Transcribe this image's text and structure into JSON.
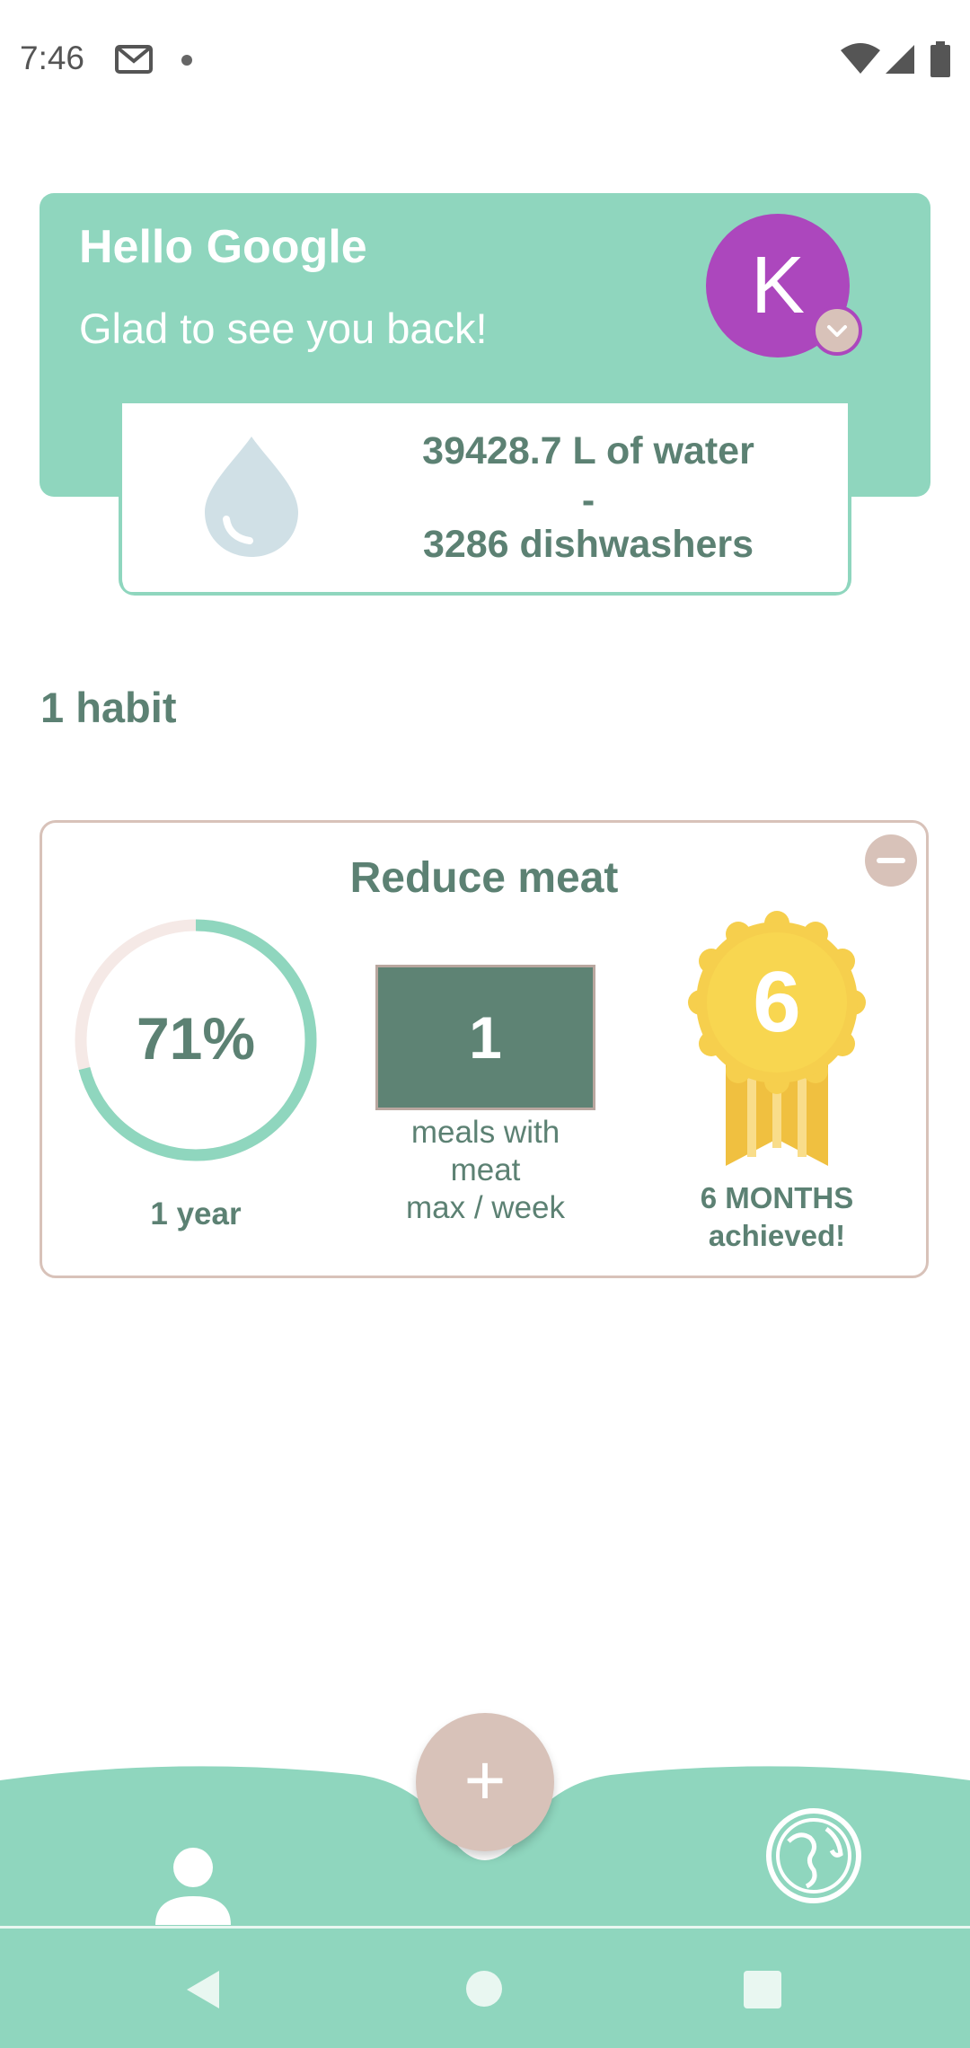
{
  "status_bar": {
    "time": "7:46"
  },
  "greeting": {
    "title": "Hello Google",
    "subtitle": "Glad to see you back!",
    "avatar_initial": "K"
  },
  "water_savings": {
    "liters": "39428.7 L of water",
    "separator": "-",
    "dishwashers": "3286 dishwashers"
  },
  "habits": {
    "count_label": "1 habit",
    "items": [
      {
        "title": "Reduce meat",
        "progress_percent": 71,
        "progress_text": "71%",
        "duration": "1 year",
        "goal_value": "1",
        "goal_caption_line1": "meals with",
        "goal_caption_line2": "meat",
        "goal_caption_line3": "max / week",
        "medal_number": "6",
        "medal_caption_line1": "6 MONTHS",
        "medal_caption_line2": "achieved!"
      }
    ]
  },
  "icons": {
    "status": [
      "gmail-icon",
      "wifi-icon",
      "signal-icon",
      "battery-icon"
    ],
    "nav": [
      "person-icon",
      "globe-icon",
      "plus-icon"
    ]
  },
  "colors": {
    "mint": "#8fd6be",
    "dark_green": "#5c8173",
    "beige": "#d8c2b9",
    "avatar": "#ac47bd",
    "gold": "#f5c744"
  }
}
